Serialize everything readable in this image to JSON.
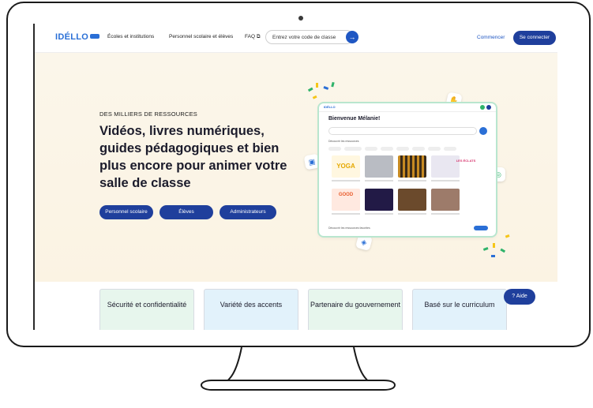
{
  "nav": {
    "logo": "IDÉLLO",
    "links": [
      "Écoles et institutions",
      "Personnel scolaire et élèves",
      "FAQ"
    ],
    "code_placeholder": "Entrez votre code de classe",
    "commencer": "Commencer",
    "connect": "Se connecter"
  },
  "hero": {
    "eyebrow": "DES MILLIERS DE RESSOURCES",
    "headline": "Vidéos, livres numériques, guides pédagogiques et bien plus encore pour animer votre salle de classe",
    "buttons": [
      "Personnel scolaire",
      "Élèves",
      "Administrateurs"
    ]
  },
  "mockup": {
    "logo": "IDÉLLO",
    "greeting": "Bienvenue Mélanie!",
    "section_label": "Découvrir les ressources",
    "section_label_2": "Découvrir les ressources favorites",
    "thumb_text_1": "YOGA",
    "thumb_text_2": "GOOD",
    "thumb_text_3": "LES ÉCLATS"
  },
  "features": [
    "Sécurité et confidentialité",
    "Variété des accents",
    "Partenaire du gouvernement",
    "Basé sur le curriculum"
  ],
  "help": "Aide",
  "colors": {
    "brand": "#1f3f9c",
    "accent": "#2a6fd6",
    "hero_bg": "#fbf5e8",
    "card_green": "#e7f6ed",
    "card_blue": "#e2f2fb"
  },
  "icons": [
    "arrow-right-icon",
    "question-icon",
    "calendar-icon",
    "fingerprint-icon",
    "tag-icon",
    "hand-icon"
  ]
}
